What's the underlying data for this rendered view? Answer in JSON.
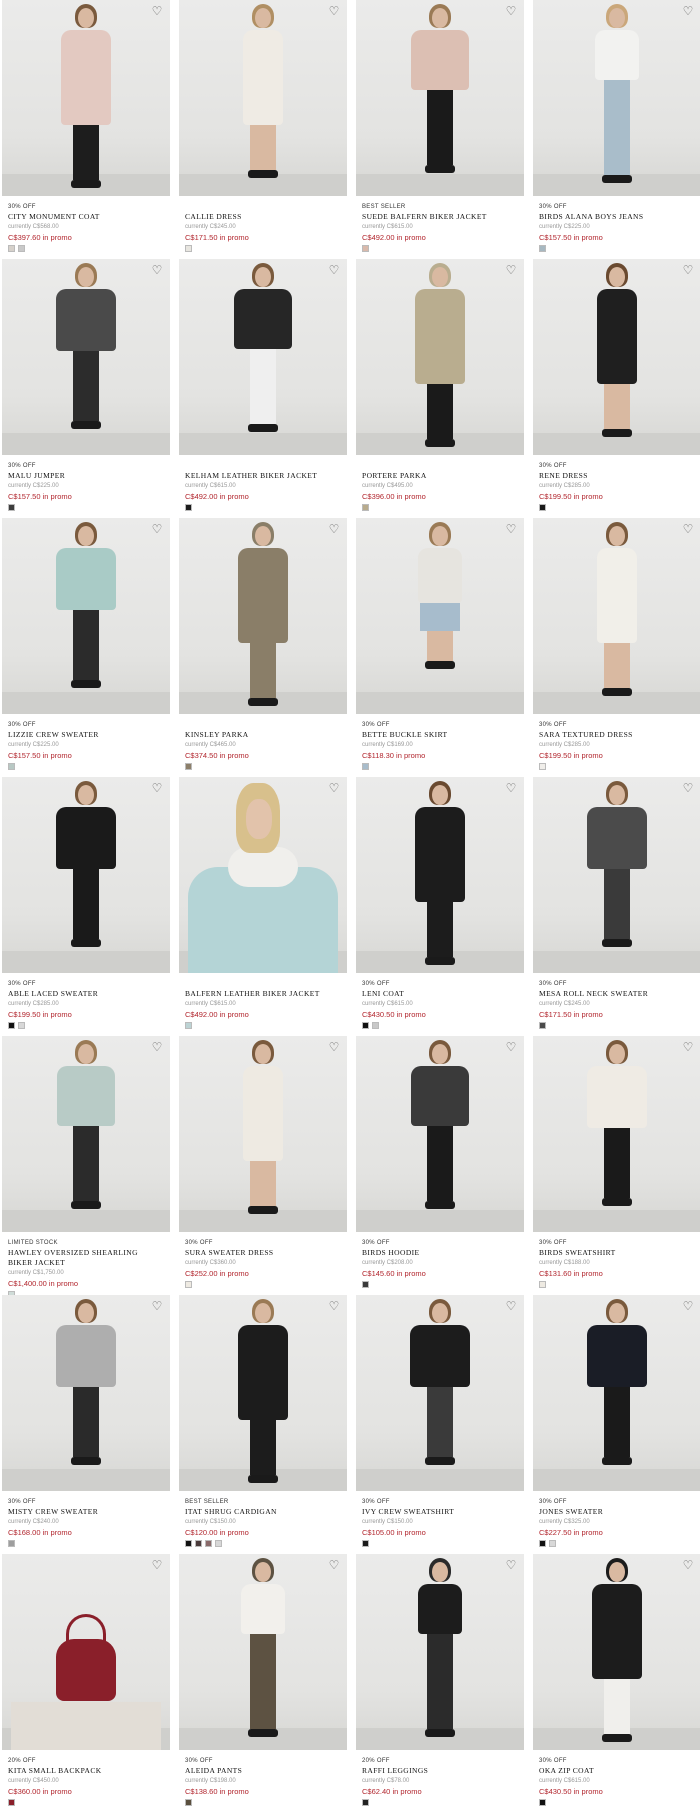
{
  "colors": {
    "promo": "#b2262e",
    "text": "#111111",
    "muted": "#999999"
  },
  "wishlist_icon": "heart-outline-icon",
  "products": [
    {
      "badge": "30% OFF",
      "name": "CITY MONUMENT COAT",
      "currently": "currently C$568.00",
      "promo": "C$397.60 in promo",
      "swatches": [
        "#d6d1cb",
        "#c9c9c9"
      ],
      "garment": "#e3c9c1",
      "bottom": "#1d1d1d",
      "hair": "#7a5a3d",
      "type": "coat"
    },
    {
      "badge": "",
      "name": "CALLIE DRESS",
      "currently": "currently C$245.00",
      "promo": "C$171.50 in promo",
      "swatches": [
        "#e8e6e0"
      ],
      "garment": "#efebe4",
      "bottom": "#efebe4",
      "hair": "#b08f63",
      "type": "dress"
    },
    {
      "badge": "BEST SELLER",
      "name": "SUEDE BALFERN BIKER JACKET",
      "currently": "currently C$615.00",
      "promo": "C$492.00 in promo",
      "swatches": [
        "#d9b9ab"
      ],
      "garment": "#dcbfb3",
      "bottom": "#1a1a1a",
      "hair": "#9a7a55",
      "type": "jacket"
    },
    {
      "badge": "30% OFF",
      "name": "BIRDS ALANA BOYS JEANS",
      "currently": "currently C$225.00",
      "promo": "C$157.50 in promo",
      "swatches": [
        "#a7b8c1"
      ],
      "garment": "#f2f2f0",
      "bottom": "#a9bdca",
      "hair": "#caa77a",
      "type": "jeans"
    },
    {
      "badge": "30% OFF",
      "name": "MALU JUMPER",
      "currently": "currently C$225.00",
      "promo": "C$157.50 in promo",
      "swatches": [
        "#3d3d3d"
      ],
      "garment": "#4a4a4a",
      "bottom": "#2c2c2c",
      "hair": "#9a7a55",
      "type": "sweater"
    },
    {
      "badge": "",
      "name": "KELHAM LEATHER BIKER JACKET",
      "currently": "currently C$615.00",
      "promo": "C$492.00 in promo",
      "swatches": [
        "#1c1c1c"
      ],
      "garment": "#262626",
      "bottom": "#efefef",
      "hair": "#7a5a3d",
      "type": "jacket"
    },
    {
      "badge": "",
      "name": "PORTERE PARKA",
      "currently": "currently C$495.00",
      "promo": "C$396.00 in promo",
      "swatches": [
        "#b8ab8d"
      ],
      "garment": "#b9ad8f",
      "bottom": "#1a1a1a",
      "hair": "#b9ad8f",
      "type": "parka"
    },
    {
      "badge": "30% OFF",
      "name": "RENE DRESS",
      "currently": "currently C$285.00",
      "promo": "C$199.50 in promo",
      "swatches": [
        "#1a1a1a"
      ],
      "garment": "#1f1f1f",
      "bottom": "#1f1f1f",
      "hair": "#6a4a30",
      "type": "dress"
    },
    {
      "badge": "30% OFF",
      "name": "LIZZIE CREW SWEATER",
      "currently": "currently C$225.00",
      "promo": "C$157.50 in promo",
      "swatches": [
        "#b8c8c4"
      ],
      "garment": "#a9cbc6",
      "bottom": "#2b2b2b",
      "hair": "#7a5a3d",
      "type": "sweater"
    },
    {
      "badge": "",
      "name": "KINSLEY PARKA",
      "currently": "currently C$465.00",
      "promo": "C$374.50 in promo",
      "swatches": [
        "#8c7f6a"
      ],
      "garment": "#8a7e68",
      "bottom": "#8a7e68",
      "hair": "#8a7e68",
      "type": "parka"
    },
    {
      "badge": "30% OFF",
      "name": "BETTE BUCKLE SKIRT",
      "currently": "currently C$169.00",
      "promo": "C$118.30 in promo",
      "swatches": [
        "#a8bccb"
      ],
      "garment": "#e6e4df",
      "bottom": "#a7bccc",
      "hair": "#9a7a55",
      "type": "skirt"
    },
    {
      "badge": "30% OFF",
      "name": "SARA TEXTURED DRESS",
      "currently": "currently C$285.00",
      "promo": "C$199.50 in promo",
      "swatches": [
        "#f0eeea"
      ],
      "garment": "#f1efe9",
      "bottom": "#f1efe9",
      "hair": "#7a5a3d",
      "type": "dress"
    },
    {
      "badge": "30% OFF",
      "name": "ABLE LACED SWEATER",
      "currently": "currently C$285.00",
      "promo": "C$199.50 in promo",
      "swatches": [
        "#111111",
        "#d8d8d8"
      ],
      "garment": "#1a1a1a",
      "bottom": "#1a1a1a",
      "hair": "#7a5a3d",
      "type": "sweater"
    },
    {
      "badge": "",
      "name": "BALFERN LEATHER BIKER JACKET",
      "currently": "currently C$615.00",
      "promo": "C$492.00 in promo",
      "swatches": [
        "#bcd3d4"
      ],
      "garment": "#b4d4d6",
      "bottom": "#f0efec",
      "hair": "#d8c08c",
      "type": "closeup"
    },
    {
      "badge": "30% OFF",
      "name": "LENI COAT",
      "currently": "currently C$615.00",
      "promo": "C$430.50 in promo",
      "swatches": [
        "#111111",
        "#c8c8c8"
      ],
      "garment": "#1c1c1c",
      "bottom": "#1c1c1c",
      "hair": "#6a4a30",
      "type": "coat"
    },
    {
      "badge": "30% OFF",
      "name": "MESA ROLL NECK SWEATER",
      "currently": "currently C$245.00",
      "promo": "C$171.50 in promo",
      "swatches": [
        "#4a4a4a"
      ],
      "garment": "#4b4b4b",
      "bottom": "#3a3a3a",
      "hair": "#7a5a3d",
      "type": "sweater"
    },
    {
      "badge": "LIMITED STOCK",
      "name": "HAWLEY OVERSIZED SHEARLING BIKER JACKET",
      "currently": "currently C$1,750.00",
      "promo": "C$1,400.00 in promo",
      "swatches": [
        "#cfdcd8"
      ],
      "garment": "#b8cbc6",
      "bottom": "#2b2b2b",
      "hair": "#9a7a55",
      "type": "jacket"
    },
    {
      "badge": "30% OFF",
      "name": "SURA SWEATER DRESS",
      "currently": "currently C$360.00",
      "promo": "C$252.00 in promo",
      "swatches": [
        "#eeeae2"
      ],
      "garment": "#eeeae2",
      "bottom": "#ffffff",
      "hair": "#7a5a3d",
      "type": "dress"
    },
    {
      "badge": "30% OFF",
      "name": "BIRDS HOODIE",
      "currently": "currently C$208.00",
      "promo": "C$145.60 in promo",
      "swatches": [
        "#3a3a3a"
      ],
      "garment": "#3a3a3a",
      "bottom": "#1a1a1a",
      "hair": "#7a5a3d",
      "type": "jacket"
    },
    {
      "badge": "30% OFF",
      "name": "BIRDS SWEATSHIRT",
      "currently": "currently C$188.00",
      "promo": "C$131.60 in promo",
      "swatches": [
        "#eeeae2"
      ],
      "garment": "#efebe4",
      "bottom": "#1a1a1a",
      "hair": "#7a5a3d",
      "type": "sweater"
    },
    {
      "badge": "30% OFF",
      "name": "MISTY CREW SWEATER",
      "currently": "currently C$240.00",
      "promo": "C$168.00 in promo",
      "swatches": [
        "#9e9e9e"
      ],
      "garment": "#aeaeae",
      "bottom": "#2a2a2a",
      "hair": "#7a5a3d",
      "type": "sweater"
    },
    {
      "badge": "BEST SELLER",
      "name": "ITAT SHRUG CARDIGAN",
      "currently": "currently C$150.00",
      "promo": "C$120.00 in promo",
      "swatches": [
        "#111111",
        "#4a3a3a",
        "#8a6a6a",
        "#d8d8d8"
      ],
      "garment": "#1c1c1c",
      "bottom": "#1c1c1c",
      "hair": "#9a7a55",
      "type": "coat"
    },
    {
      "badge": "30% OFF",
      "name": "IVY CREW SWEATSHIRT",
      "currently": "currently C$150.00",
      "promo": "C$105.00 in promo",
      "swatches": [
        "#1a1a1a"
      ],
      "garment": "#1c1c1c",
      "bottom": "#3a3a3a",
      "hair": "#7a5a3d",
      "type": "sweater"
    },
    {
      "badge": "30% OFF",
      "name": "JONES SWEATER",
      "currently": "currently C$325.00",
      "promo": "C$227.50 in promo",
      "swatches": [
        "#111111",
        "#d8d8d8"
      ],
      "garment": "#1a1d26",
      "bottom": "#1a1a1a",
      "hair": "#7a5a3d",
      "type": "sweater"
    },
    {
      "badge": "20% OFF",
      "name": "KITA SMALL BACKPACK",
      "currently": "currently C$450.00",
      "promo": "C$360.00 in promo",
      "swatches": [
        "#8a1f2a"
      ],
      "garment": "#8a1f2a",
      "bottom": "#e8e4de",
      "hair": "#8a1f2a",
      "type": "bag"
    },
    {
      "badge": "30% OFF",
      "name": "ALEIDA PANTS",
      "currently": "currently C$198.00",
      "promo": "C$138.60 in promo",
      "swatches": [
        "#5a4f3e"
      ],
      "garment": "#f2f0ec",
      "bottom": "#5d5242",
      "hair": "#5d5242",
      "type": "pants"
    },
    {
      "badge": "20% OFF",
      "name": "RAFFI LEGGINGS",
      "currently": "currently C$78.00",
      "promo": "C$62.40 in promo",
      "swatches": [
        "#222222"
      ],
      "garment": "#1c1c1c",
      "bottom": "#2b2b2b",
      "hair": "#2b2b2b",
      "type": "pants"
    },
    {
      "badge": "30% OFF",
      "name": "OKA ZIP COAT",
      "currently": "currently C$615.00",
      "promo": "C$430.50 in promo",
      "swatches": [
        "#111111"
      ],
      "garment": "#1c1c1c",
      "bottom": "#f0efec",
      "hair": "#1c1c1c",
      "type": "coat"
    }
  ]
}
